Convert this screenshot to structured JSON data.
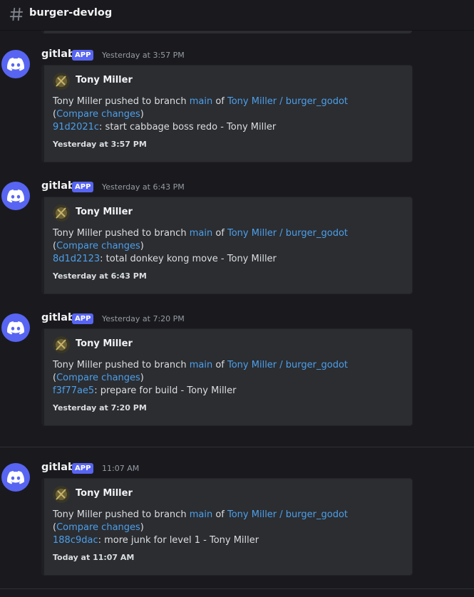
{
  "header": {
    "channel": "burger-devlog",
    "icon": "hash-icon"
  },
  "messages": [
    {
      "user": "gitlab",
      "badge": "APP",
      "timestamp": "Yesterday at 3:57 PM",
      "embed": {
        "author": "Tony Miller",
        "pusher": "Tony Miller",
        "pushed_text": "pushed to branch",
        "branch": "main",
        "of_text": "of",
        "repo": "Tony Miller / burger_godot",
        "compare": "Compare changes",
        "commit_hash": "91d2021c",
        "commit_msg": "start cabbage boss redo - Tony Miller",
        "footer": "Yesterday at 3:57 PM"
      }
    },
    {
      "user": "gitlab",
      "badge": "APP",
      "timestamp": "Yesterday at 6:43 PM",
      "embed": {
        "author": "Tony Miller",
        "pusher": "Tony Miller",
        "pushed_text": "pushed to branch",
        "branch": "main",
        "of_text": "of",
        "repo": "Tony Miller / burger_godot",
        "compare": "Compare changes",
        "commit_hash": "8d1d2123",
        "commit_msg": "total donkey kong move - Tony Miller",
        "footer": "Yesterday at 6:43 PM"
      }
    },
    {
      "user": "gitlab",
      "badge": "APP",
      "timestamp": "Yesterday at 7:20 PM",
      "embed": {
        "author": "Tony Miller",
        "pusher": "Tony Miller",
        "pushed_text": "pushed to branch",
        "branch": "main",
        "of_text": "of",
        "repo": "Tony Miller / burger_godot",
        "compare": "Compare changes",
        "commit_hash": "f3f77ae5",
        "commit_msg": "prepare for build - Tony Miller",
        "footer": "Yesterday at 7:20 PM"
      }
    },
    {
      "user": "gitlab",
      "badge": "APP",
      "timestamp": "11:07 AM",
      "embed": {
        "author": "Tony Miller",
        "pusher": "Tony Miller",
        "pushed_text": "pushed to branch",
        "branch": "main",
        "of_text": "of",
        "repo": "Tony Miller / burger_godot",
        "compare": "Compare changes",
        "commit_hash": "188c9dac",
        "commit_msg": "more junk for level 1 - Tony Miller",
        "footer": "Today at 11:07 AM"
      }
    }
  ],
  "colors": {
    "accent": "#5865f2",
    "link": "#4d9fea",
    "embed_bg": "#2b2d31",
    "bg": "#1a1a1e"
  }
}
